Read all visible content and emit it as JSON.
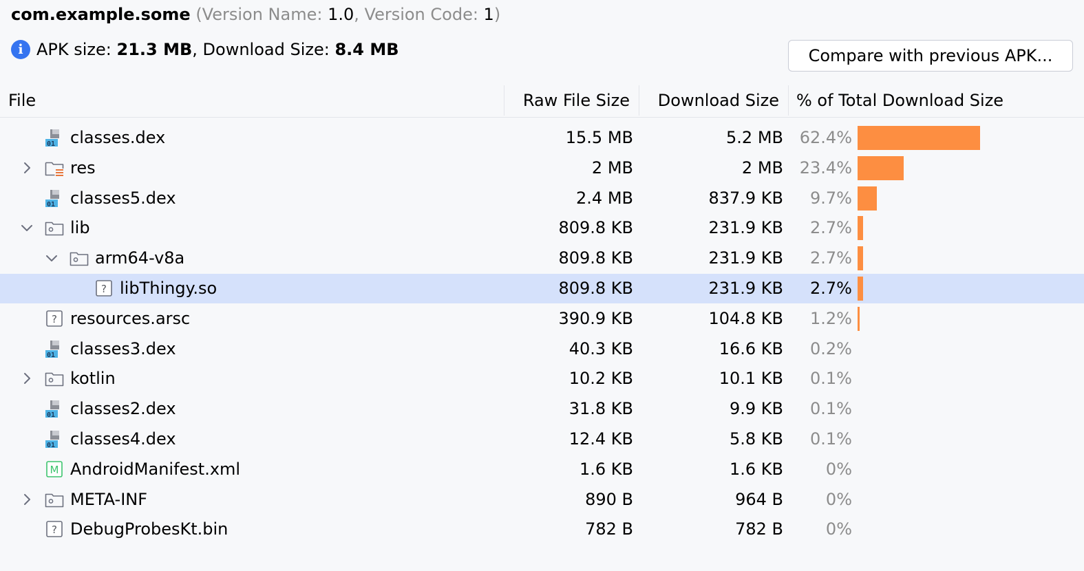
{
  "header": {
    "package": "com.example.some",
    "version_open": "(Version Name: ",
    "version_name": "1.0",
    "version_sep": ", Version Code: ",
    "version_code": "1",
    "version_close": ")"
  },
  "size_info": {
    "apk_label": "APK size: ",
    "apk_value": "21.3 MB",
    "download_label": ", Download Size: ",
    "download_value": "8.4 MB",
    "icon": "info-icon"
  },
  "compare_button": "Compare with previous APK...",
  "columns": {
    "file": "File",
    "raw": "Raw File Size",
    "download": "Download Size",
    "percent": "% of Total Download Size"
  },
  "colors": {
    "bar": "#fd8e41",
    "selection": "#d5e1fb",
    "info": "#3574f0"
  },
  "rows": [
    {
      "name": "classes.dex",
      "icon": "dex",
      "depth": 0,
      "expander": "none",
      "raw": "15.5 MB",
      "download": "5.2 MB",
      "percent": "62.4%",
      "pct": 62.4
    },
    {
      "name": "res",
      "icon": "res-folder",
      "depth": 0,
      "expander": "collapsed",
      "raw": "2 MB",
      "download": "2 MB",
      "percent": "23.4%",
      "pct": 23.4
    },
    {
      "name": "classes5.dex",
      "icon": "dex",
      "depth": 0,
      "expander": "none",
      "raw": "2.4 MB",
      "download": "837.9 KB",
      "percent": "9.7%",
      "pct": 9.7
    },
    {
      "name": "lib",
      "icon": "folder",
      "depth": 0,
      "expander": "expanded",
      "raw": "809.8 KB",
      "download": "231.9 KB",
      "percent": "2.7%",
      "pct": 2.7
    },
    {
      "name": "arm64-v8a",
      "icon": "folder",
      "depth": 1,
      "expander": "expanded",
      "raw": "809.8 KB",
      "download": "231.9 KB",
      "percent": "2.7%",
      "pct": 2.7
    },
    {
      "name": "libThingy.so",
      "icon": "unknown",
      "depth": 2,
      "expander": "none",
      "raw": "809.8 KB",
      "download": "231.9 KB",
      "percent": "2.7%",
      "pct": 2.7,
      "selected": true
    },
    {
      "name": "resources.arsc",
      "icon": "unknown",
      "depth": 0,
      "expander": "none",
      "raw": "390.9 KB",
      "download": "104.8 KB",
      "percent": "1.2%",
      "pct": 1.2
    },
    {
      "name": "classes3.dex",
      "icon": "dex",
      "depth": 0,
      "expander": "none",
      "raw": "40.3 KB",
      "download": "16.6 KB",
      "percent": "0.2%",
      "pct": 0.2
    },
    {
      "name": "kotlin",
      "icon": "folder",
      "depth": 0,
      "expander": "collapsed",
      "raw": "10.2 KB",
      "download": "10.1 KB",
      "percent": "0.1%",
      "pct": 0.1
    },
    {
      "name": "classes2.dex",
      "icon": "dex",
      "depth": 0,
      "expander": "none",
      "raw": "31.8 KB",
      "download": "9.9 KB",
      "percent": "0.1%",
      "pct": 0.1
    },
    {
      "name": "classes4.dex",
      "icon": "dex",
      "depth": 0,
      "expander": "none",
      "raw": "12.4 KB",
      "download": "5.8 KB",
      "percent": "0.1%",
      "pct": 0.1
    },
    {
      "name": "AndroidManifest.xml",
      "icon": "manifest",
      "depth": 0,
      "expander": "none",
      "raw": "1.6 KB",
      "download": "1.6 KB",
      "percent": "0%",
      "pct": 0
    },
    {
      "name": "META-INF",
      "icon": "folder",
      "depth": 0,
      "expander": "collapsed",
      "raw": "890 B",
      "download": "964 B",
      "percent": "0%",
      "pct": 0
    },
    {
      "name": "DebugProbesKt.bin",
      "icon": "unknown",
      "depth": 0,
      "expander": "none",
      "raw": "782 B",
      "download": "782 B",
      "percent": "0%",
      "pct": 0
    }
  ]
}
